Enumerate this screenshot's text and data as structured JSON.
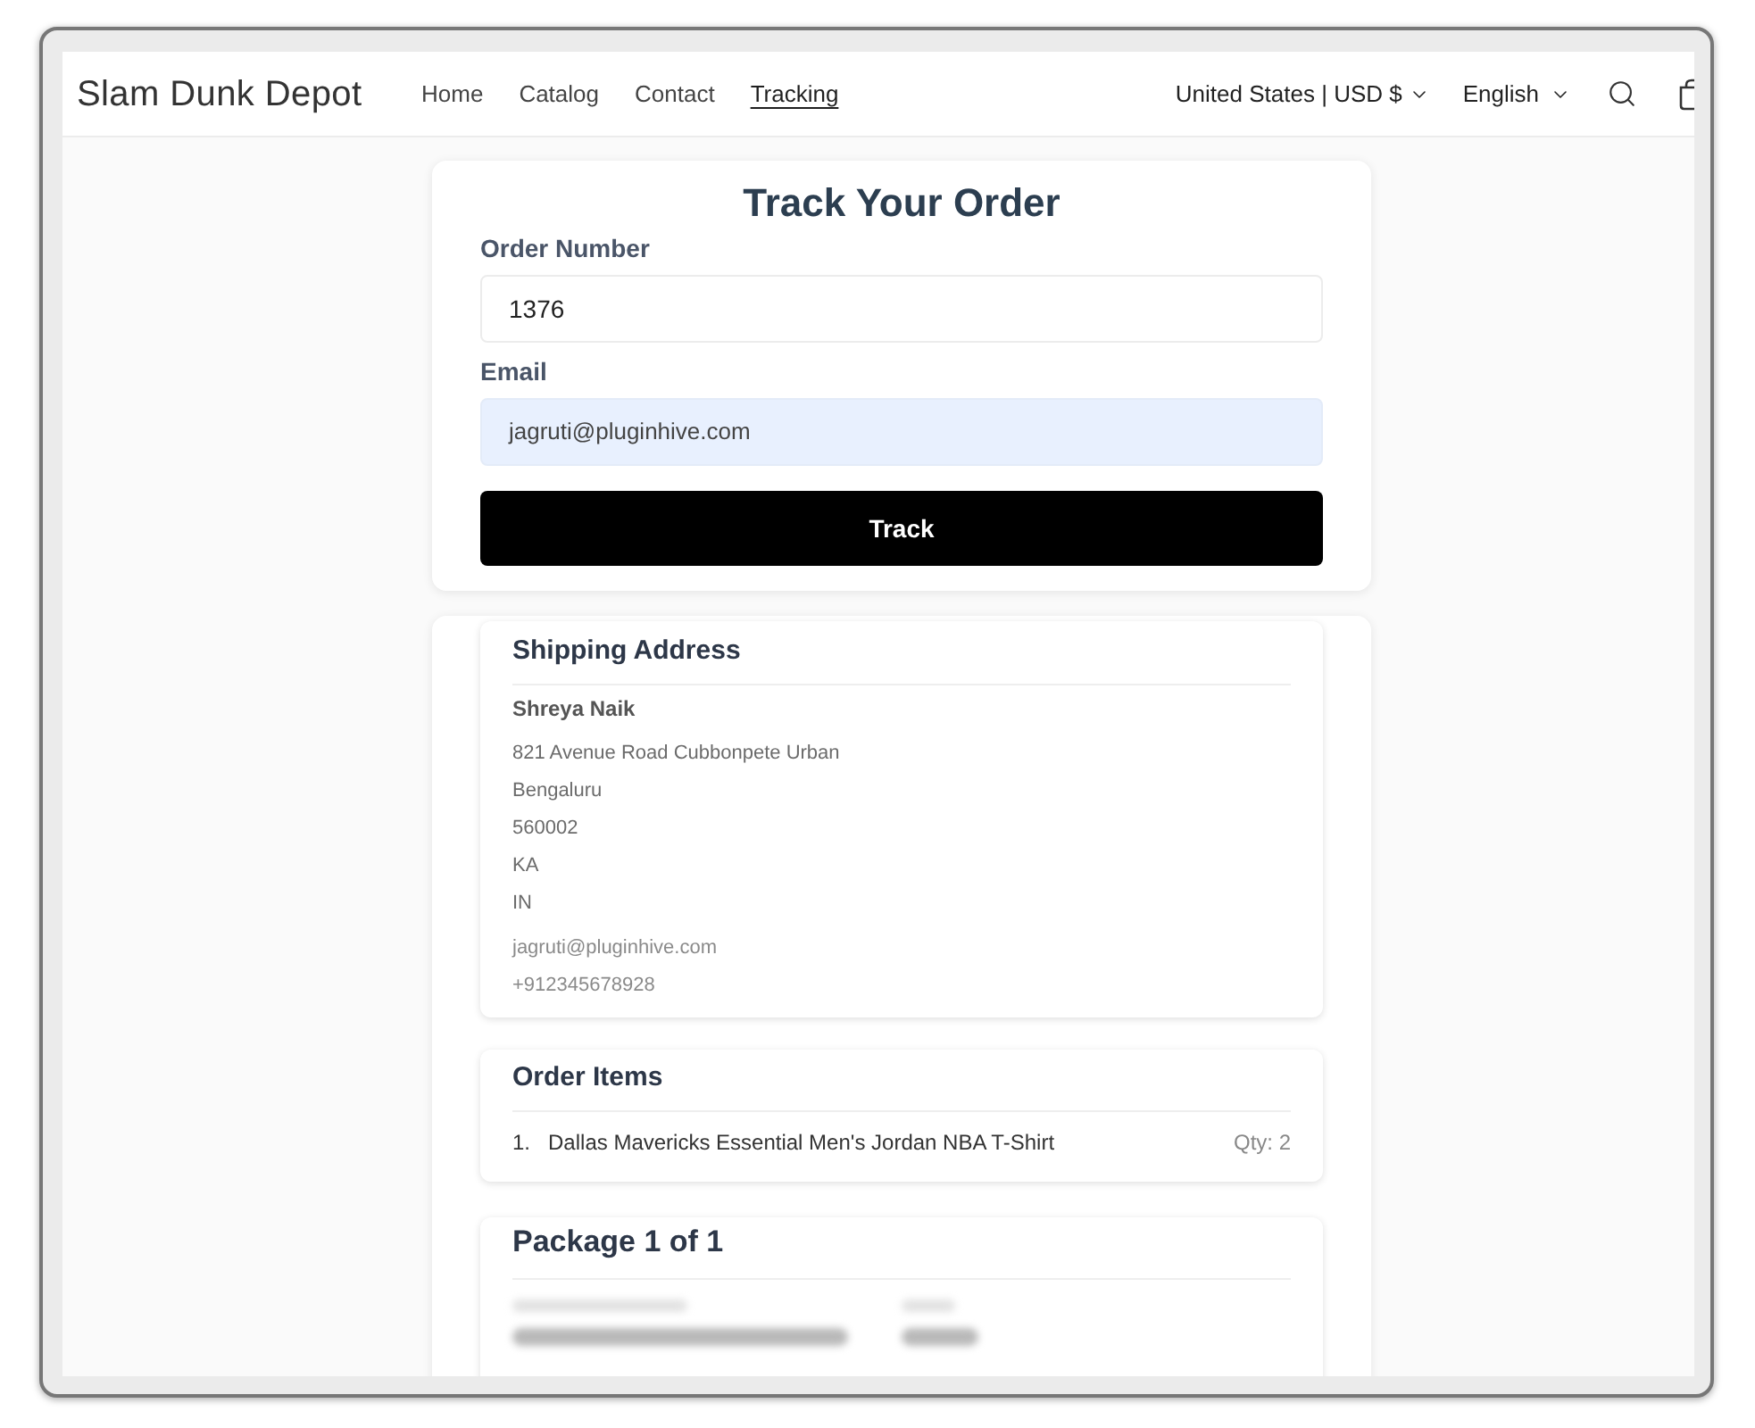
{
  "header": {
    "logo": "Slam Dunk Depot",
    "nav": [
      {
        "label": "Home",
        "selected": false
      },
      {
        "label": "Catalog",
        "selected": false
      },
      {
        "label": "Contact",
        "selected": false
      },
      {
        "label": "Tracking",
        "selected": true
      }
    ],
    "country_selector": "United States | USD $",
    "language_selector": "English"
  },
  "track_form": {
    "title": "Track Your Order",
    "fields": [
      {
        "label": "Order Number",
        "value": "1376",
        "autofilled": false
      },
      {
        "label": "Email",
        "value": "jagruti@pluginhive.com",
        "autofilled": true
      }
    ],
    "button": "Track"
  },
  "shipping_address": {
    "title": "Shipping Address",
    "name": "Shreya Naik",
    "lines": [
      "821 Avenue Road Cubbonpete Urban",
      "Bengaluru",
      "560002",
      "KA",
      "IN"
    ],
    "email": "jagruti@pluginhive.com",
    "phone": "+912345678928"
  },
  "order_items": {
    "title": "Order Items",
    "items": [
      {
        "number": "1.",
        "name": "Dallas Mavericks Essential Men's Jordan NBA T-Shirt",
        "quantity": "Qty: 2"
      }
    ]
  },
  "package": {
    "title": "Package 1 of 1"
  }
}
